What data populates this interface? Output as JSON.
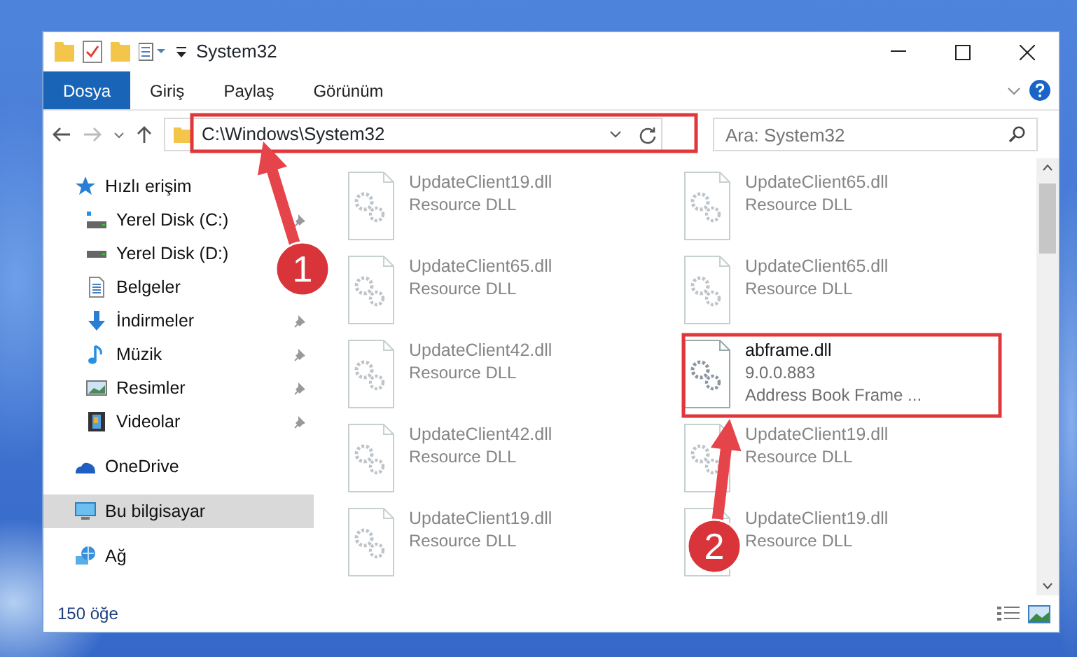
{
  "window": {
    "title": "System32"
  },
  "ribbon_tabs": [
    {
      "label": "Dosya",
      "selected": true
    },
    {
      "label": "Giriş",
      "selected": false
    },
    {
      "label": "Paylaş",
      "selected": false
    },
    {
      "label": "Görünüm",
      "selected": false
    }
  ],
  "address_bar": {
    "path": "C:\\Windows\\System32",
    "highlighted": true
  },
  "search": {
    "placeholder": "Ara: System32"
  },
  "sidebar": {
    "items": [
      {
        "label": "Hızlı erişim",
        "selected": false,
        "children": [
          {
            "label": "Yerel Disk (C:)",
            "pinned": true
          },
          {
            "label": "Yerel Disk (D:)",
            "pinned": false
          },
          {
            "label": "Belgeler",
            "pinned": false
          },
          {
            "label": "İndirmeler",
            "pinned": true
          },
          {
            "label": "Müzik",
            "pinned": true
          },
          {
            "label": "Resimler",
            "pinned": true
          },
          {
            "label": "Videolar",
            "pinned": true
          }
        ]
      },
      {
        "label": "OneDrive",
        "selected": false
      },
      {
        "label": "Bu bilgisayar",
        "selected": true
      },
      {
        "label": "Ağ",
        "selected": false
      }
    ]
  },
  "files": [
    {
      "name": "UpdateClient19.dll",
      "details": [
        "Resource DLL"
      ],
      "blurred": true,
      "highlighted": false
    },
    {
      "name": "UpdateClient65.dll",
      "details": [
        "Resource DLL"
      ],
      "blurred": true,
      "highlighted": false
    },
    {
      "name": "UpdateClient65.dll",
      "details": [
        "Resource DLL"
      ],
      "blurred": true,
      "highlighted": false
    },
    {
      "name": "UpdateClient65.dll",
      "details": [
        "Resource DLL"
      ],
      "blurred": true,
      "highlighted": false
    },
    {
      "name": "UpdateClient42.dll",
      "details": [
        "Resource DLL"
      ],
      "blurred": true,
      "highlighted": false
    },
    {
      "name": "abframe.dll",
      "details": [
        "9.0.0.883",
        "Address Book Frame ..."
      ],
      "blurred": false,
      "highlighted": true
    },
    {
      "name": "UpdateClient42.dll",
      "details": [
        "Resource DLL"
      ],
      "blurred": true,
      "highlighted": false
    },
    {
      "name": "UpdateClient19.dll",
      "details": [
        "Resource DLL"
      ],
      "blurred": true,
      "highlighted": false
    },
    {
      "name": "UpdateClient19.dll",
      "details": [
        "Resource DLL"
      ],
      "blurred": true,
      "highlighted": false
    },
    {
      "name": "UpdateClient19.dll",
      "details": [
        "Resource DLL"
      ],
      "blurred": true,
      "highlighted": false
    }
  ],
  "status_bar": {
    "item_count": "150 öğe"
  },
  "annotations": [
    {
      "label": "1"
    },
    {
      "label": "2"
    }
  ]
}
